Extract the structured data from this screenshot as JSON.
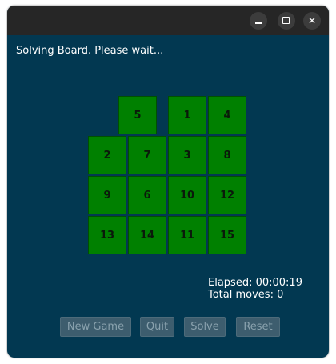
{
  "status": "Solving Board. Please wait...",
  "elapsed": "Elapsed: 00:00:19",
  "moves": "Total moves: 0",
  "tiles": [
    "5",
    "1",
    "4",
    "2",
    "7",
    "3",
    "8",
    "9",
    "6",
    "10",
    "12",
    "13",
    "14",
    "11",
    "15"
  ],
  "buttons": {
    "new_game": "New Game",
    "quit": "Quit",
    "solve": "Solve",
    "reset": "Reset"
  },
  "colors": {
    "background": "#023851",
    "tile": "#008000"
  }
}
